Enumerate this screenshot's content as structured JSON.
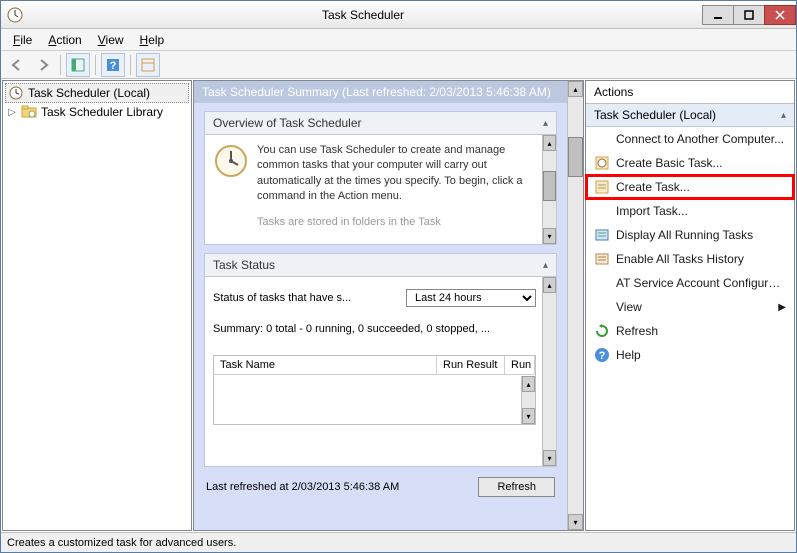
{
  "window": {
    "title": "Task Scheduler"
  },
  "menu": {
    "file": "File",
    "action": "Action",
    "view": "View",
    "help": "Help"
  },
  "tree": {
    "root": "Task Scheduler (Local)",
    "child": "Task Scheduler Library"
  },
  "center": {
    "summary_header": "Task Scheduler Summary (Last refreshed: 2/03/2013 5:46:38 AM)",
    "overview_title": "Overview of Task Scheduler",
    "overview_text": "You can use Task Scheduler to create and manage common tasks that your computer will carry out automatically at the times you specify. To begin, click a command in the Action menu.",
    "overview_text2": "Tasks are stored in folders in the Task",
    "status_title": "Task Status",
    "status_label": "Status of tasks that have s...",
    "status_select": "Last 24 hours",
    "summary_line": "Summary: 0 total - 0 running, 0 succeeded, 0 stopped, ...",
    "th_name": "Task Name",
    "th_result": "Run Result",
    "th_run": "Run",
    "last_refreshed": "Last refreshed at 2/03/2013 5:46:38 AM",
    "refresh_btn": "Refresh"
  },
  "actions": {
    "title": "Actions",
    "group": "Task Scheduler (Local)",
    "items": [
      "Connect to Another Computer...",
      "Create Basic Task...",
      "Create Task...",
      "Import Task...",
      "Display All Running Tasks",
      "Enable All Tasks History",
      "AT Service Account Configurati...",
      "View",
      "Refresh",
      "Help"
    ]
  },
  "statusbar": "Creates a customized task for advanced users."
}
